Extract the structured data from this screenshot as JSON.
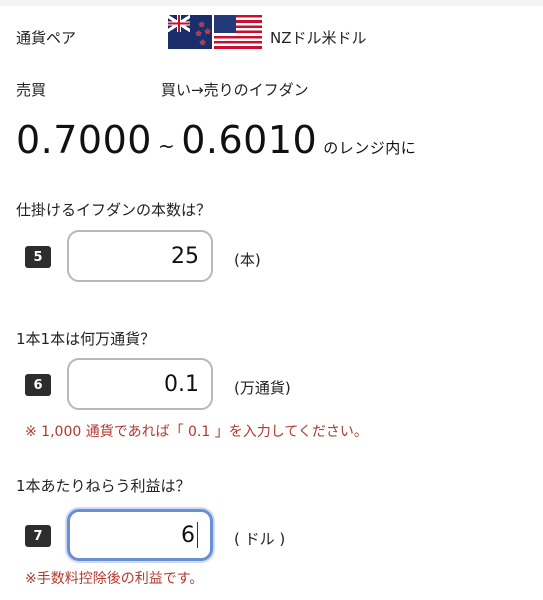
{
  "pair": {
    "label": "通貨ペア",
    "value": "NZドル米ドル"
  },
  "trade": {
    "label": "売買",
    "value": "買い→売りのイフダン"
  },
  "rate": {
    "from": "0.7000",
    "tilde": "~",
    "to": "0.6010",
    "suffix": "のレンジ内に"
  },
  "q_count": {
    "question": "仕掛けるイフダンの本数は？",
    "badge": "5",
    "value": "25",
    "unit": "(本)"
  },
  "q_size": {
    "question": "1本1本は何万通貨？",
    "badge": "6",
    "value": "0.1",
    "unit": "(万通貨)",
    "note": "※ 1,000 通貨であれば「 0.1 」を入力してください。"
  },
  "q_profit": {
    "question": "1本あたりねらう利益は？",
    "badge": "7",
    "value": "6",
    "unit": "( ドル )",
    "note": "※手数料控除後の利益です。"
  },
  "colors": {
    "badge": "#2d2d2d",
    "note": "#b23a2e",
    "focus": "#6b8fd6"
  },
  "icons": {
    "flag_left": "new-zealand-flag-icon",
    "flag_right": "us-flag-icon"
  }
}
